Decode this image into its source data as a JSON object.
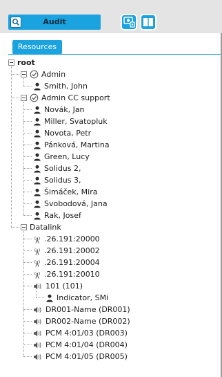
{
  "toolbar": {
    "search_icon": "search-icon",
    "audit_label": "Audit",
    "buttons": [
      {
        "icon": "monitor-icon"
      },
      {
        "icon": "book-icon"
      }
    ],
    "accent": "#1ba3e0"
  },
  "tabs": [
    {
      "label": "Resources",
      "active": true
    }
  ],
  "tree": {
    "root_label": "root",
    "groups": [
      {
        "label": "Admin",
        "icon": "group-check-icon",
        "children": [
          {
            "label": "Smith, John",
            "icon": "user-icon"
          }
        ]
      },
      {
        "label": "Admin CC support",
        "icon": "group-check-icon",
        "children": [
          {
            "label": "Novák, Jan",
            "icon": "user-icon"
          },
          {
            "label": "Miller, Svatopluk",
            "icon": "user-icon"
          },
          {
            "label": "Novota, Petr",
            "icon": "user-icon"
          },
          {
            "label": "Pánková, Martina",
            "icon": "user-icon"
          },
          {
            "label": "Green, Lucy",
            "icon": "user-icon"
          },
          {
            "label": "Solidus 2,",
            "icon": "user-icon"
          },
          {
            "label": "Solidus 3,",
            "icon": "user-icon"
          },
          {
            "label": "Šimáček, Mira",
            "icon": "user-icon"
          },
          {
            "label": "Svobodová, Jana",
            "icon": "user-icon"
          },
          {
            "label": "Rak, Josef",
            "icon": "user-icon"
          }
        ]
      },
      {
        "label": "Datalink",
        "icon": "",
        "children": [
          {
            "label": ".26.191:20000",
            "icon": "antenna-icon"
          },
          {
            "label": ".26.191:20002",
            "icon": "antenna-icon"
          },
          {
            "label": ".26.191:20004",
            "icon": "antenna-icon"
          },
          {
            "label": ".26.191:20010",
            "icon": "antenna-icon"
          },
          {
            "label": "101 (101)",
            "icon": "speaker-icon",
            "children": [
              {
                "label": "Indicator, SMi",
                "icon": "user-icon"
              }
            ]
          },
          {
            "label": "DR001-Name (DR001)",
            "icon": "speaker-icon"
          },
          {
            "label": "DR002-Name (DR002)",
            "icon": "speaker-icon"
          },
          {
            "label": "PCM 4:01/03 (DR003)",
            "icon": "speaker-icon"
          },
          {
            "label": "PCM 4:01/04 (DR004)",
            "icon": "speaker-icon"
          },
          {
            "label": "PCM 4:01/05 (DR005)",
            "icon": "speaker-icon"
          }
        ]
      }
    ]
  }
}
